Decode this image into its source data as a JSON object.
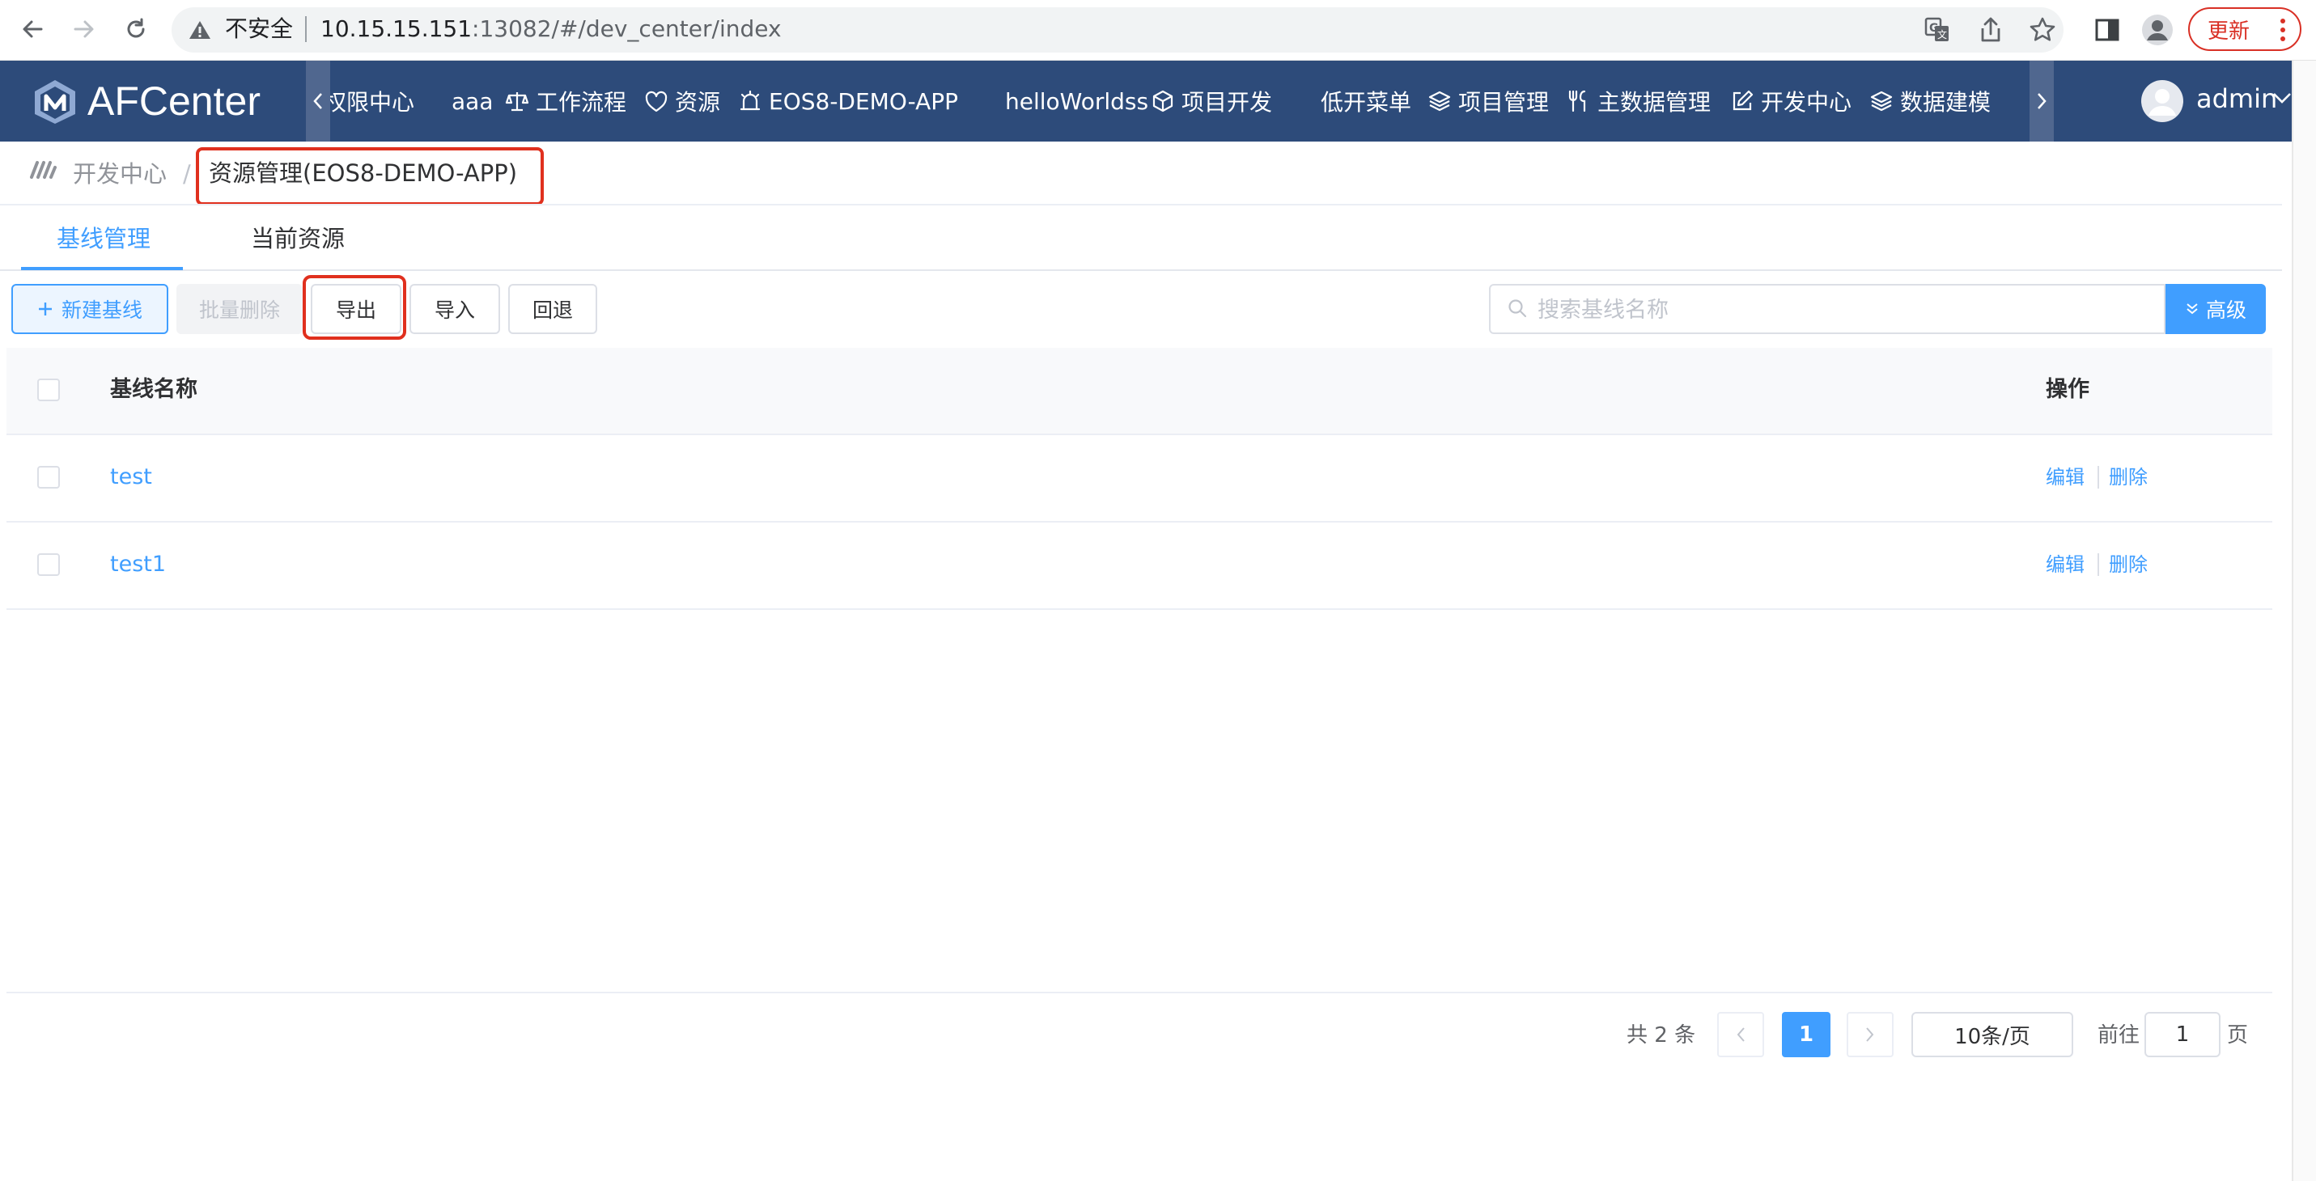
{
  "browser": {
    "security_label": "不安全",
    "url_host": "10.15.15.151",
    "url_rest": ":13082/#/dev_center/index",
    "update_label": "更新"
  },
  "app": {
    "brand": "AFCenter",
    "nav": [
      {
        "label": "权限中心",
        "icon": "none"
      },
      {
        "label": "aaa",
        "icon": "none"
      },
      {
        "label": "工作流程",
        "icon": "scale-icon"
      },
      {
        "label": "资源",
        "icon": "heart-shield-icon"
      },
      {
        "label": "EOS8-DEMO-APP",
        "icon": "alarm-icon"
      },
      {
        "label": "helloWorldss",
        "icon": "none"
      },
      {
        "label": "项目开发",
        "icon": "cube-icon"
      },
      {
        "label": "低开菜单",
        "icon": "none"
      },
      {
        "label": "项目管理",
        "icon": "layers-icon"
      },
      {
        "label": "主数据管理",
        "icon": "tools-icon"
      },
      {
        "label": "开发中心",
        "icon": "edit-icon"
      },
      {
        "label": "数据建模",
        "icon": "layers-icon"
      }
    ],
    "active_nav": "开发中心",
    "user": "admin"
  },
  "breadcrumb": {
    "root": "开发中心",
    "separator": "/",
    "current": "资源管理(EOS8-DEMO-APP)"
  },
  "tabs": [
    {
      "label": "基线管理",
      "active": true
    },
    {
      "label": "当前资源",
      "active": false
    }
  ],
  "toolbar": {
    "new_label": "新建基线",
    "batch_delete_label": "批量删除",
    "export_label": "导出",
    "import_label": "导入",
    "rollback_label": "回退",
    "search_placeholder": "搜索基线名称",
    "advanced_label": "高级"
  },
  "table": {
    "columns": [
      "基线名称",
      "操作"
    ],
    "rows": [
      {
        "name": "test",
        "actions": [
          "编辑",
          "删除"
        ]
      },
      {
        "name": "test1",
        "actions": [
          "编辑",
          "删除"
        ]
      }
    ]
  },
  "pagination": {
    "total_label": "共 2 条",
    "current_page": "1",
    "page_size_label": "10条/页",
    "goto_label": "前往",
    "goto_value": "1",
    "page_suffix": "页"
  },
  "colors": {
    "header_bg": "#2d4b7a",
    "primary": "#409eff",
    "highlight_box": "#e0301e"
  }
}
